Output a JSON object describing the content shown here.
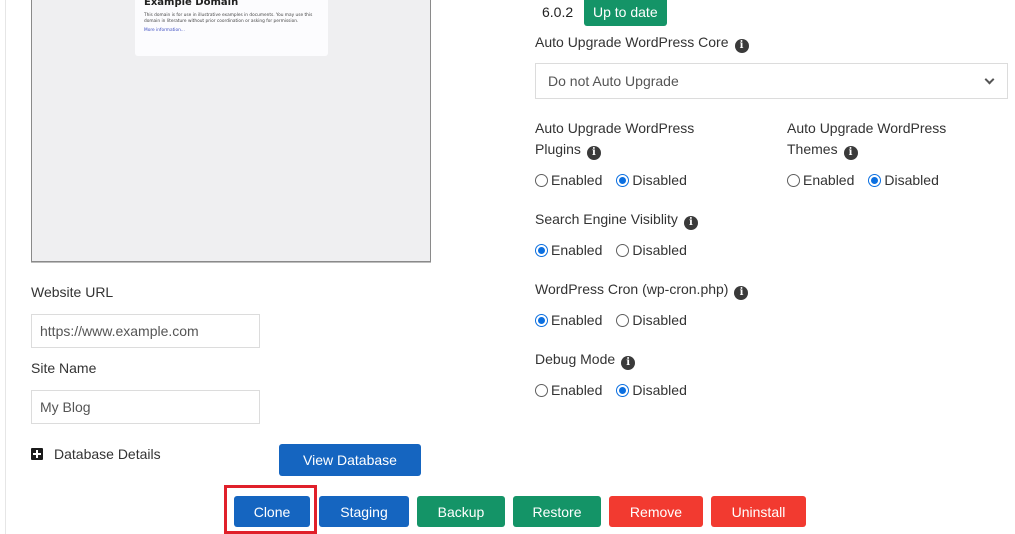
{
  "preview": {
    "title": "Example Domain",
    "text": "This domain is for use in illustrative examples in documents. You may use this domain in literature without prior coordination or asking for permission.",
    "link": "More information..."
  },
  "website_url": {
    "label": "Website URL",
    "value": "https://www.example.com"
  },
  "site_name": {
    "label": "Site Name",
    "value": "My Blog"
  },
  "database": {
    "details_label": "Database Details",
    "toggle_icon": "plus-square-icon",
    "view_button": "View Database"
  },
  "wordpress": {
    "version": "6.0.2",
    "status_badge": "Up to date",
    "status_color": "#149467"
  },
  "settings": {
    "core": {
      "label": "Auto Upgrade WordPress Core",
      "selected": "Do not Auto Upgrade"
    },
    "plugins": {
      "label": "Auto Upgrade WordPress Plugins",
      "options": [
        "Enabled",
        "Disabled"
      ],
      "selected": "Disabled"
    },
    "themes": {
      "label": "Auto Upgrade WordPress Themes",
      "options": [
        "Enabled",
        "Disabled"
      ],
      "selected": "Disabled"
    },
    "search_engine": {
      "label": "Search Engine Visiblity",
      "options": [
        "Enabled",
        "Disabled"
      ],
      "selected": "Enabled"
    },
    "cron": {
      "label": "WordPress Cron (wp-cron.php)",
      "options": [
        "Enabled",
        "Disabled"
      ],
      "selected": "Enabled"
    },
    "debug": {
      "label": "Debug Mode",
      "options": [
        "Enabled",
        "Disabled"
      ],
      "selected": "Disabled"
    }
  },
  "actions": {
    "clone": "Clone",
    "staging": "Staging",
    "backup": "Backup",
    "restore": "Restore",
    "remove": "Remove",
    "uninstall": "Uninstall",
    "highlighted": "Clone"
  },
  "colors": {
    "primary": "#1565c0",
    "success": "#149467",
    "danger": "#f23a30",
    "highlight": "#e0202a",
    "radio_checked": "#0b6fe0"
  }
}
